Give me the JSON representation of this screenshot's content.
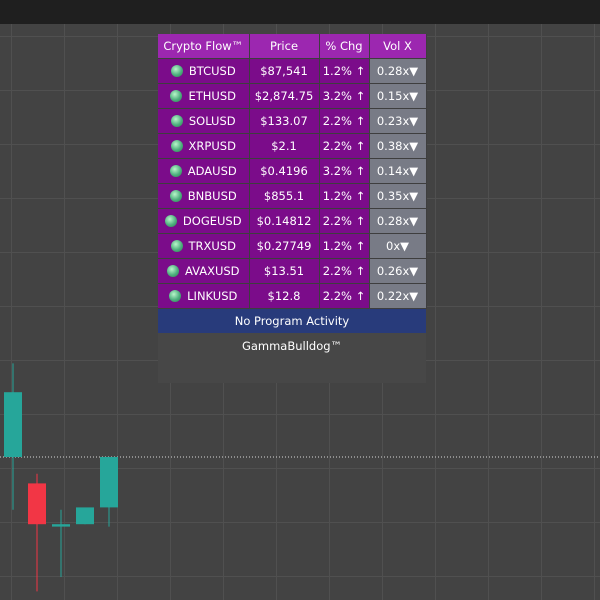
{
  "colors": {
    "header_bg": "#9c27b0",
    "row_bg": "#7b0c8a",
    "vol_bg": "#787b86",
    "status_bg": "#283b7b",
    "bull_candle": "#26a69a",
    "bear_candle": "#f23645",
    "indicator_dot": "#4caf7d"
  },
  "table": {
    "headers": {
      "name": "Crypto Flow™",
      "price": "Price",
      "change": "% Chg",
      "vol": "Vol X"
    },
    "rows": [
      {
        "symbol": "BTCUSD",
        "price": "$87,541",
        "change": "1.2% ↑",
        "vol": "0.28x▼",
        "indicator": "green-dot-icon"
      },
      {
        "symbol": "ETHUSD",
        "price": "$2,874.75",
        "change": "3.2% ↑",
        "vol": "0.15x▼",
        "indicator": "green-dot-icon"
      },
      {
        "symbol": "SOLUSD",
        "price": "$133.07",
        "change": "2.2% ↑",
        "vol": "0.23x▼",
        "indicator": "green-dot-icon"
      },
      {
        "symbol": "XRPUSD",
        "price": "$2.1",
        "change": "2.2% ↑",
        "vol": "0.38x▼",
        "indicator": "green-dot-icon"
      },
      {
        "symbol": "ADAUSD",
        "price": "$0.4196",
        "change": "3.2% ↑",
        "vol": "0.14x▼",
        "indicator": "green-dot-icon"
      },
      {
        "symbol": "BNBUSD",
        "price": "$855.1",
        "change": "1.2% ↑",
        "vol": "0.35x▼",
        "indicator": "green-dot-icon"
      },
      {
        "symbol": "DOGEUSD",
        "price": "$0.14812",
        "change": "2.2% ↑",
        "vol": "0.28x▼",
        "indicator": "green-dot-icon"
      },
      {
        "symbol": "TRXUSD",
        "price": "$0.27749",
        "change": "1.2% ↑",
        "vol": "0x▼",
        "indicator": "green-dot-icon"
      },
      {
        "symbol": "AVAXUSD",
        "price": "$13.51",
        "change": "2.2% ↑",
        "vol": "0.26x▼",
        "indicator": "green-dot-icon"
      },
      {
        "symbol": "LINKUSD",
        "price": "$12.8",
        "change": "2.2% ↑",
        "vol": "0.22x▼",
        "indicator": "green-dot-icon"
      }
    ]
  },
  "status": {
    "text": "No Program Activity"
  },
  "brand": {
    "text": "GammaBulldog™"
  },
  "candles": {
    "price_line": 100.0,
    "bars": [
      {
        "open": 100.0,
        "high": 103.9,
        "low": 97.8,
        "close": 102.7
      },
      {
        "open": 98.9,
        "high": 99.3,
        "low": 94.4,
        "close": 97.2
      },
      {
        "open": 97.1,
        "high": 97.8,
        "low": 95.0,
        "close": 97.2
      },
      {
        "open": 97.2,
        "high": 97.8,
        "low": 97.2,
        "close": 97.9
      },
      {
        "open": 97.9,
        "high": 100.0,
        "low": 97.1,
        "close": 100.0
      }
    ]
  }
}
